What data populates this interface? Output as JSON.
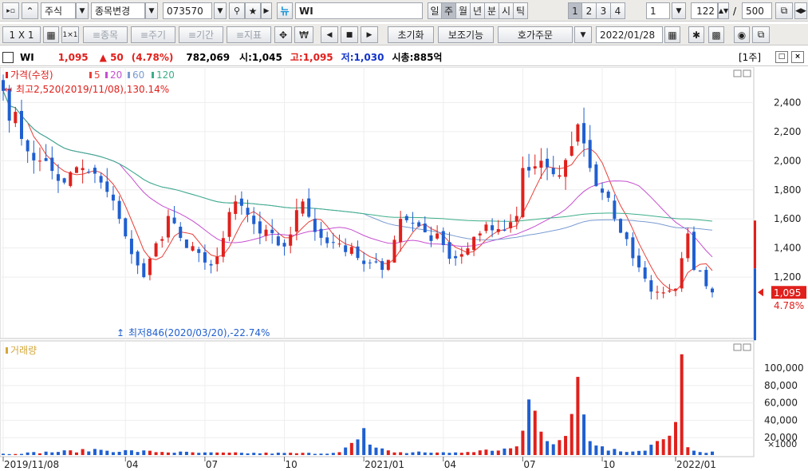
{
  "toolbar1": {
    "market": "주식",
    "change_stock": "종목변경",
    "code": "073570",
    "new_badge": "뉴",
    "stock_name": "WI",
    "periods": [
      "일",
      "주",
      "월",
      "년",
      "분",
      "시",
      "틱"
    ],
    "selected_period": "주",
    "minute_options": [
      "1",
      "2",
      "3",
      "4"
    ],
    "interval_value": "1",
    "bar_count": "122",
    "bar_separator": "/",
    "bar_total": "500"
  },
  "toolbar2": {
    "layout": "1 X 1",
    "tools": [
      "종목",
      "주기",
      "기간",
      "지표"
    ],
    "reset": "초기화",
    "aux": "보조기능",
    "order": "호가주문",
    "date": "2022/01/28"
  },
  "info": {
    "name": "WI",
    "price": "1,095",
    "change": "▲ 50",
    "change_rate": "(4.78%)",
    "volume": "782,069",
    "open_label": "시:",
    "open": "1,045",
    "high_label": "고:",
    "high": "1,095",
    "low_label": "저:",
    "low": "1,030",
    "mcap_label": "시총:",
    "mcap": "885억",
    "period_tag": "[1주]"
  },
  "colors": {
    "up": "#e0201c",
    "down": "#1f5fd0",
    "ma5": "#e8413a",
    "ma20": "#c64fd0",
    "ma60": "#7a9bd2",
    "ma120": "#3dae8a"
  },
  "chart_data": {
    "type": "candlestick",
    "price_panel": {
      "legend": [
        "가격(수정)",
        "5",
        "20",
        "60",
        "120"
      ],
      "annotation_high": "최고2,520(2019/11/08),130.14%",
      "annotation_low": "최저846(2020/03/20),-22.74%",
      "y_ticks": [
        2400,
        2200,
        2000,
        1800,
        1600,
        1400,
        1200
      ],
      "y_tick_labels": [
        "2,400",
        "2,200",
        "2,000",
        "1,800",
        "1,600",
        "1,400",
        "1,200"
      ],
      "ylim": [
        800,
        2600
      ],
      "current_price_label": "1,095",
      "current_rate_label": "4.78%",
      "current_price": 1095
    },
    "volume_panel": {
      "title": "거래량",
      "unit_label": "×1000",
      "y_ticks": [
        20000,
        40000,
        60000,
        80000,
        100000
      ],
      "y_tick_labels": [
        "20,000",
        "40,000",
        "60,000",
        "80,000",
        "100,000"
      ],
      "ylim": [
        0,
        125000
      ]
    },
    "x_labels": [
      "2019/11/08",
      "04",
      "07",
      "10",
      "2021/01",
      "04",
      "07",
      "10",
      "2022/01"
    ],
    "x_label_index": [
      0,
      20,
      33,
      46,
      59,
      72,
      85,
      98,
      110
    ],
    "weeks": 117,
    "anchors": {
      "index": [
        0,
        3,
        6,
        10,
        13,
        16,
        19,
        20,
        23,
        27,
        30,
        33,
        35,
        38,
        42,
        46,
        49,
        52,
        55,
        59,
        62,
        65,
        68,
        72,
        74,
        78,
        81,
        84,
        85,
        88,
        91,
        93,
        94,
        96,
        98,
        100,
        103,
        106,
        108,
        110,
        112,
        113,
        116
      ],
      "close": [
        2480,
        2150,
        2000,
        1850,
        1950,
        1850,
        1600,
        1480,
        1200,
        1620,
        1400,
        1300,
        1340,
        1720,
        1500,
        1410,
        1720,
        1470,
        1430,
        1290,
        1250,
        1600,
        1550,
        1420,
        1330,
        1500,
        1530,
        1620,
        1950,
        2000,
        1900,
        2100,
        2250,
        1950,
        1780,
        1600,
        1330,
        1100,
        1095,
        1120,
        1500,
        1250,
        1095
      ]
    },
    "volume_anchors": {
      "index": [
        0,
        15,
        33,
        54,
        58,
        59,
        60,
        64,
        68,
        74,
        84,
        85,
        86,
        89,
        92,
        94,
        96,
        98,
        100,
        105,
        110,
        111,
        112,
        113,
        116
      ],
      "volume": [
        1500,
        7000,
        3000,
        2500,
        18000,
        31000,
        12000,
        3000,
        4000,
        3000,
        10000,
        28000,
        64000,
        16000,
        22000,
        90000,
        16000,
        10000,
        7000,
        5000,
        38000,
        116000,
        9000,
        5000,
        4000
      ]
    }
  }
}
